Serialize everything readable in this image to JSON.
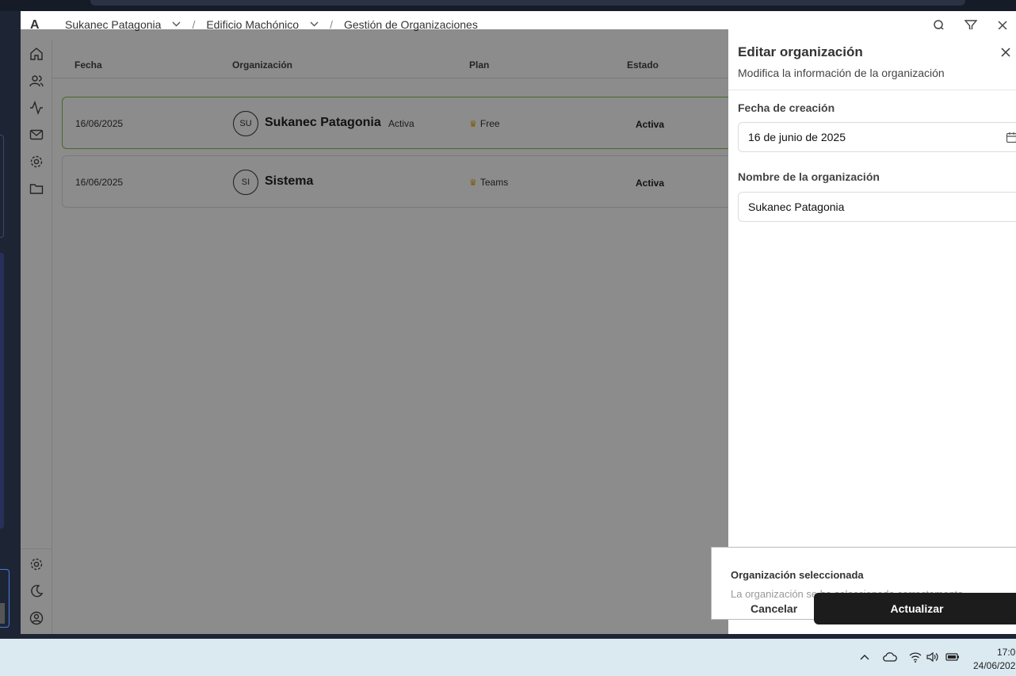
{
  "header": {
    "logo": "A",
    "breadcrumbs": [
      "Sukanec Patagonia",
      "Edificio Machónico",
      "Gestión de Organizaciones"
    ],
    "separator": "/"
  },
  "table": {
    "columns": [
      "Fecha",
      "Organización",
      "Plan",
      "Estado"
    ],
    "rows": [
      {
        "date": "16/06/2025",
        "initials": "SU",
        "name": "Sukanec Patagonia",
        "badge": "Activa",
        "plan": "Free",
        "status": "Activa",
        "selected": true
      },
      {
        "date": "16/06/2025",
        "initials": "SI",
        "name": "Sistema",
        "badge": "",
        "plan": "Teams",
        "status": "Activa",
        "selected": false
      }
    ]
  },
  "panel": {
    "title": "Editar organización",
    "subtitle": "Modifica la información de la organización",
    "date_label": "Fecha de creación",
    "date_value": "16 de junio de 2025",
    "name_label": "Nombre de la organización",
    "name_value": "Sukanec Patagonia",
    "cancel_label": "Cancelar",
    "update_label": "Actualizar"
  },
  "toast": {
    "title": "Organización seleccionada",
    "message": "La organización se ha seleccionado correctamente"
  },
  "taskbar": {
    "time": "17:0",
    "date": "24/06/202"
  },
  "colors": {
    "accent_green": "#7cc24a",
    "crown": "#e3a400",
    "primary_button": "#1c1c1c"
  }
}
